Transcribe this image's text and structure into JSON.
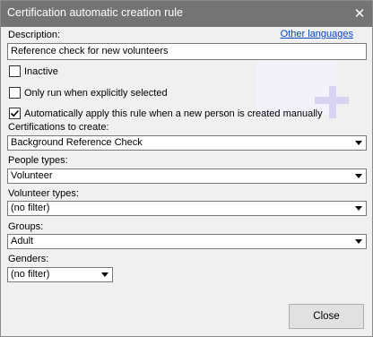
{
  "window": {
    "title": "Certification automatic creation rule",
    "close_glyph": "✕"
  },
  "link": {
    "other_languages": "Other languages"
  },
  "description": {
    "label": "Description:",
    "value": "Reference check for new volunteers"
  },
  "checkboxes": [
    {
      "label": "Inactive",
      "checked": false
    },
    {
      "label": "Only run when explicitly selected",
      "checked": false
    },
    {
      "label": "Automatically apply this rule when a new person is created manually",
      "checked": true
    }
  ],
  "fields": {
    "certifications": {
      "label": "Certifications to create:",
      "value": "Background Reference Check"
    },
    "people_types": {
      "label": "People types:",
      "value": "Volunteer"
    },
    "volunteer_types": {
      "label": "Volunteer types:",
      "value": "(no filter)"
    },
    "groups": {
      "label": "Groups:",
      "value": "Adult"
    },
    "genders": {
      "label": "Genders:",
      "value": "(no filter)"
    }
  },
  "buttons": {
    "close": "Close"
  },
  "colors": {
    "titlebar": "#747474",
    "background": "#f0f0f0",
    "link": "#0645c8",
    "decoration": "#d9d3f3"
  }
}
